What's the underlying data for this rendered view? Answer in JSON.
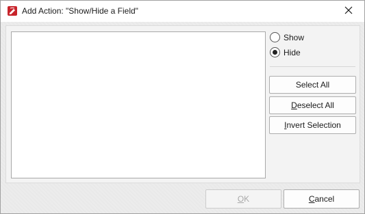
{
  "window": {
    "title": "Add Action: \"Show/Hide a Field\"",
    "app_icon": "pdf-editor-icon",
    "close_icon": "close-icon"
  },
  "visibility": {
    "options": [
      {
        "label": "Show",
        "selected": false
      },
      {
        "label": "Hide",
        "selected": true
      }
    ]
  },
  "selection_buttons": {
    "select_all": "Select All",
    "deselect_all": "Deselect All",
    "invert_selection": "Invert Selection"
  },
  "footer": {
    "ok": "OK",
    "cancel": "Cancel"
  },
  "colors": {
    "app_icon_red": "#c8242b",
    "radio_dot": "#222222"
  }
}
